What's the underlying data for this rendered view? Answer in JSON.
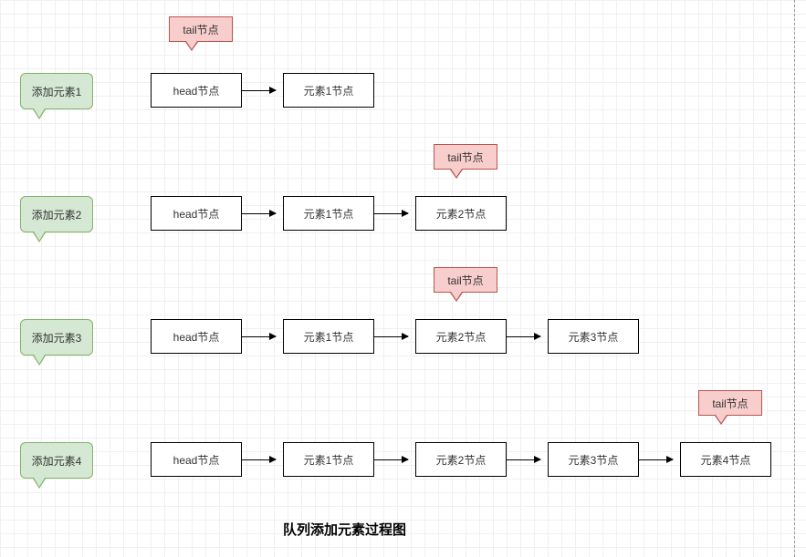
{
  "title": "队列添加元素过程图",
  "labels": {
    "tail": "tail节点",
    "head": "head节点",
    "add1": "添加元素1",
    "add2": "添加元素2",
    "add3": "添加元素3",
    "add4": "添加元素4",
    "elem1": "元素1节点",
    "elem2": "元素2节点",
    "elem3": "元素3节点",
    "elem4": "元素4节点"
  },
  "rows": [
    {
      "step": "添加元素1",
      "nodes": [
        "head节点",
        "元素1节点"
      ],
      "tailIndex": 0
    },
    {
      "step": "添加元素2",
      "nodes": [
        "head节点",
        "元素1节点",
        "元素2节点"
      ],
      "tailIndex": 2
    },
    {
      "step": "添加元素3",
      "nodes": [
        "head节点",
        "元素1节点",
        "元素2节点",
        "元素3节点"
      ],
      "tailIndex": 2
    },
    {
      "step": "添加元素4",
      "nodes": [
        "head节点",
        "元素1节点",
        "元素2节点",
        "元素3节点",
        "元素4节点"
      ],
      "tailIndex": 4
    }
  ]
}
